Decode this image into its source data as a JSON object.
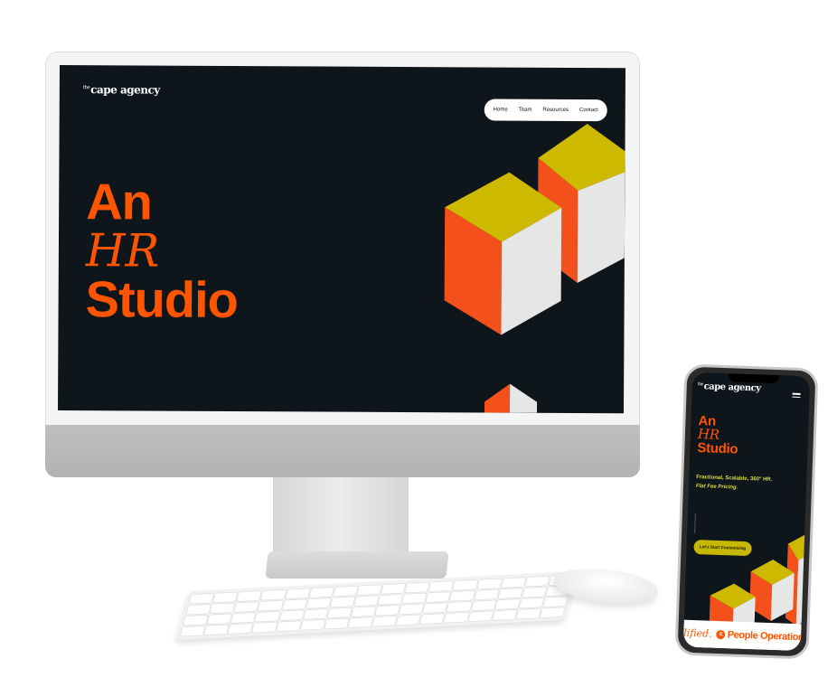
{
  "site": {
    "logo_sup": "the",
    "logo_text": "cape agency",
    "nav": [
      "Home",
      "Team",
      "Resources",
      "Contact"
    ],
    "hero": {
      "line1": "An",
      "line2": "HR",
      "line3": "Studio"
    }
  },
  "mobile": {
    "tagline_plain": "Fractional, Scalable, 360° HR.",
    "tagline_italic": "Flat Fee Pricing.",
    "cta_label": "Let's Start Customizing",
    "marquee_left": "lified.",
    "marquee_icon": "c",
    "marquee_right": "People Operations"
  },
  "colors": {
    "background": "#0e151b",
    "accent": "#ff5500",
    "cube_top": "#cdb900",
    "cube_front": "#f4501b",
    "cube_side": "#e6e6e6",
    "cta": "#c6b700"
  },
  "icons": [
    "menu-icon",
    "cube-graphic"
  ]
}
